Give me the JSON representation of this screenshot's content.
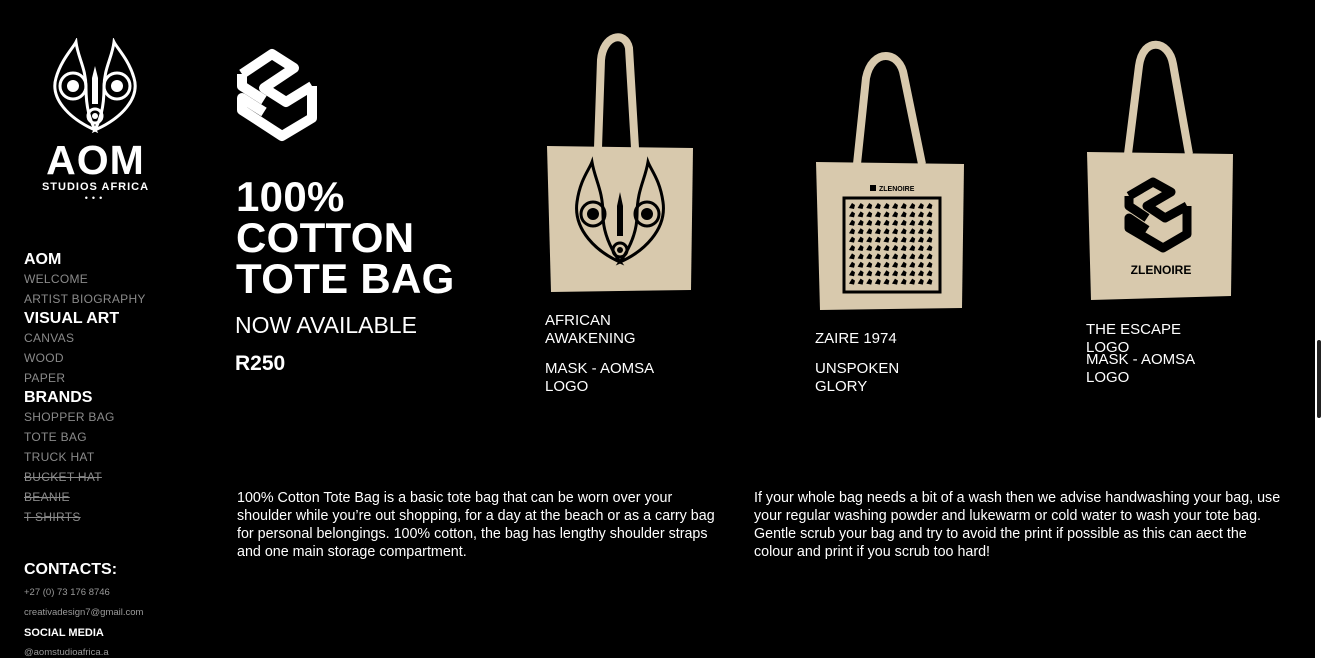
{
  "brand": {
    "title": "AOM",
    "subtitle": "STUDIOS AFRICA",
    "dots": "•••"
  },
  "nav": {
    "sections": [
      {
        "heading": "AOM",
        "items": [
          {
            "label": "WELCOME",
            "strike": false
          },
          {
            "label": "ARTIST BIOGRAPHY",
            "strike": false
          }
        ]
      },
      {
        "heading": "VISUAL ART",
        "items": [
          {
            "label": "CANVAS",
            "strike": false
          },
          {
            "label": "WOOD",
            "strike": false
          },
          {
            "label": "PAPER",
            "strike": false
          }
        ]
      },
      {
        "heading": "BRANDS",
        "items": [
          {
            "label": "SHOPPER BAG",
            "strike": false
          },
          {
            "label": "TOTE BAG",
            "strike": false
          },
          {
            "label": "TRUCK HAT",
            "strike": false
          },
          {
            "label": "BUCKET HAT",
            "strike": true
          },
          {
            "label": "BEANIE",
            "strike": true
          },
          {
            "label": "T SHIRTS",
            "strike": true
          }
        ]
      }
    ]
  },
  "contacts": {
    "heading": "CONTACTS:",
    "phone": "+27 (0) 73 176 8746",
    "email": "creativadesign7@gmail.com",
    "social_heading": "SOCIAL MEDIA",
    "social_handle": "@aomstudioafrica.a"
  },
  "hero": {
    "title": "100%\nCOTTON\nTOTE BAG",
    "subtitle": "NOW AVAILABLE",
    "price": "R250"
  },
  "products": [
    {
      "name": "AFRICAN\nAWAKENING",
      "detail": "MASK - AOMSA\nLOGO",
      "print": "mask-icon"
    },
    {
      "name": "ZAIRE 1974",
      "detail": "UNSPOKEN GLORY",
      "print": "zlenoire-pattern",
      "print_label": "ZLENOIRE"
    },
    {
      "name": "THE ESCAPE LOGO",
      "detail": "MASK - AOMSA\nLOGO",
      "print": "zlenoire-logo",
      "print_label": "ZLENOIRE"
    }
  ],
  "descriptions": {
    "left": "100% Cotton Tote Bag is a basic tote bag that can be worn over your shoulder while you’re out shopping, for a day at the beach or as a carry bag for personal belongings. 100% cotton, the bag has lengthy shoulder straps and one main storage compartment.",
    "right": "If your whole bag needs a bit of a wash then we advise handwashing your bag, use your regular washing powder and lukewarm or cold water to wash your tote bag. Gentle scrub your bag and try to avoid the print if possible as this can aect the colour and print if you scrub too hard!"
  },
  "colors": {
    "background": "#000000",
    "bag": "#d8c9ad",
    "nav_item": "#8a8a8a"
  }
}
